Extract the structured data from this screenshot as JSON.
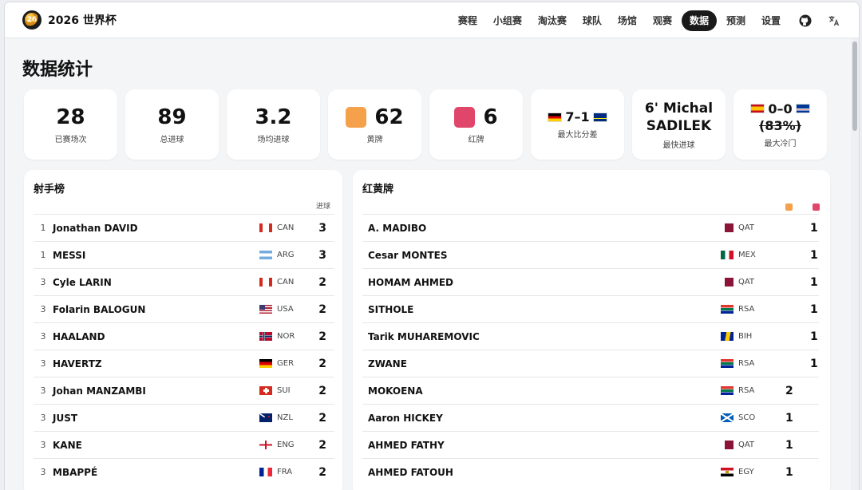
{
  "app": {
    "title": "2026 世界杯",
    "logo_text": "26"
  },
  "nav": {
    "items": [
      {
        "label": "赛程"
      },
      {
        "label": "小组赛"
      },
      {
        "label": "淘汰赛"
      },
      {
        "label": "球队"
      },
      {
        "label": "场馆"
      },
      {
        "label": "观赛"
      },
      {
        "label": "数据",
        "active": true
      },
      {
        "label": "预测"
      },
      {
        "label": "设置"
      }
    ],
    "icons": [
      "github-icon",
      "translate-icon"
    ]
  },
  "page_title": "数据统计",
  "stats": {
    "played": {
      "value": "28",
      "label": "已赛场次"
    },
    "goals": {
      "value": "89",
      "label": "总进球"
    },
    "avg": {
      "value": "3.2",
      "label": "场均进球"
    },
    "yellow": {
      "value": "62",
      "label": "黄牌",
      "color": "#f5a04a"
    },
    "red": {
      "value": "6",
      "label": "红牌",
      "color": "#e0466a"
    },
    "biggest": {
      "value": "7–1",
      "label": "最大比分差"
    },
    "fastest": {
      "value": "6' Michal SADILEK",
      "line1": "6' Michal",
      "line2": "SADILEK",
      "label": "最快进球"
    },
    "upset": {
      "value": "0–0",
      "sub": "(83%)",
      "label": "最大冷门"
    }
  },
  "scorers": {
    "title": "射手榜",
    "col_goals": "进球",
    "rows": [
      {
        "rank": "1",
        "name": "Jonathan DAVID",
        "team": "CAN",
        "flag": "can",
        "goals": "3"
      },
      {
        "rank": "1",
        "name": "MESSI",
        "team": "ARG",
        "flag": "arg",
        "goals": "3"
      },
      {
        "rank": "3",
        "name": "Cyle LARIN",
        "team": "CAN",
        "flag": "can",
        "goals": "2"
      },
      {
        "rank": "3",
        "name": "Folarin BALOGUN",
        "team": "USA",
        "flag": "usa",
        "goals": "2"
      },
      {
        "rank": "3",
        "name": "HAALAND",
        "team": "NOR",
        "flag": "nor",
        "goals": "2"
      },
      {
        "rank": "3",
        "name": "HAVERTZ",
        "team": "GER",
        "flag": "ger",
        "goals": "2"
      },
      {
        "rank": "3",
        "name": "Johan MANZAMBI",
        "team": "SUI",
        "flag": "sui",
        "goals": "2"
      },
      {
        "rank": "3",
        "name": "JUST",
        "team": "NZL",
        "flag": "nzl",
        "goals": "2"
      },
      {
        "rank": "3",
        "name": "KANE",
        "team": "ENG",
        "flag": "eng",
        "goals": "2"
      },
      {
        "rank": "3",
        "name": "MBAPPÉ",
        "team": "FRA",
        "flag": "fra",
        "goals": "2"
      }
    ]
  },
  "cards": {
    "title": "红黄牌",
    "yellow_color": "#f5a04a",
    "red_color": "#e0466a",
    "rows": [
      {
        "name": "A. MADIBO",
        "team": "QAT",
        "flag": "qat",
        "yellow": "",
        "red": "1"
      },
      {
        "name": "Cesar MONTES",
        "team": "MEX",
        "flag": "mex",
        "yellow": "",
        "red": "1"
      },
      {
        "name": "HOMAM AHMED",
        "team": "QAT",
        "flag": "qat",
        "yellow": "",
        "red": "1"
      },
      {
        "name": "SITHOLE",
        "team": "RSA",
        "flag": "rsa",
        "yellow": "",
        "red": "1"
      },
      {
        "name": "Tarik MUHAREMOVIC",
        "team": "BIH",
        "flag": "bih",
        "yellow": "",
        "red": "1"
      },
      {
        "name": "ZWANE",
        "team": "RSA",
        "flag": "rsa",
        "yellow": "",
        "red": "1"
      },
      {
        "name": "MOKOENA",
        "team": "RSA",
        "flag": "rsa",
        "yellow": "2",
        "red": ""
      },
      {
        "name": "Aaron HICKEY",
        "team": "SCO",
        "flag": "sco",
        "yellow": "1",
        "red": ""
      },
      {
        "name": "AHMED FATHY",
        "team": "QAT",
        "flag": "qat",
        "yellow": "1",
        "red": ""
      },
      {
        "name": "AHMED FATOUH",
        "team": "EGY",
        "flag": "egy",
        "yellow": "1",
        "red": ""
      }
    ]
  }
}
